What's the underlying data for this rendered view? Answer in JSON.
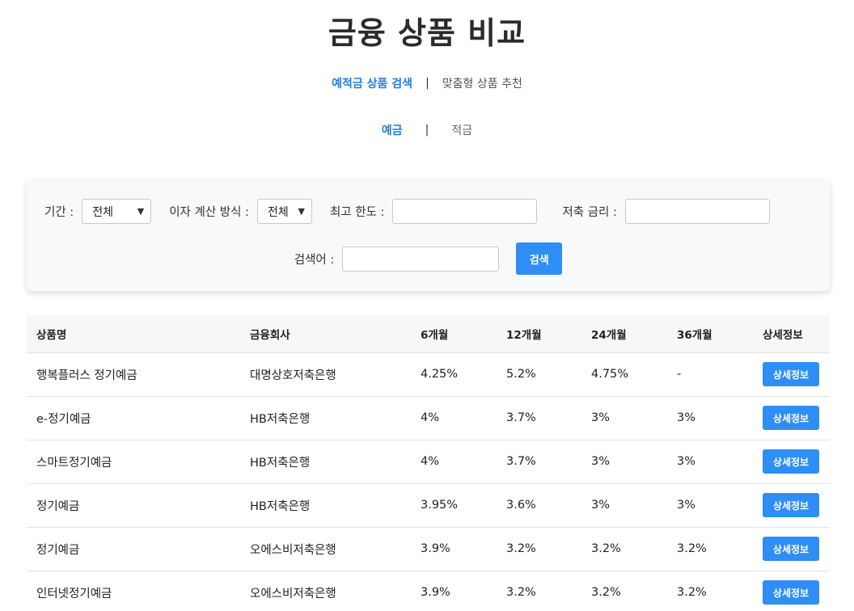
{
  "page": {
    "title": "금융 상품 비교"
  },
  "main_nav": {
    "items": [
      {
        "label": "예적금 상품 검색",
        "active": true
      },
      {
        "label": "맞춤형 상품 추천",
        "active": false
      }
    ],
    "separator": "|"
  },
  "sub_nav": {
    "items": [
      {
        "label": "예금",
        "active": true
      },
      {
        "label": "적금",
        "active": false
      }
    ],
    "separator": "|"
  },
  "filters": {
    "period_label": "기간 :",
    "period_value": "전체",
    "interest_label": "이자 계산 방식 :",
    "interest_value": "전체",
    "max_limit_label": "최고 한도 :",
    "max_limit_value": "",
    "rate_label": "저축 금리 :",
    "rate_value": "",
    "keyword_label": "검색어 :",
    "keyword_value": "",
    "search_button": "검색",
    "chevron_icon": "chevron-down-icon"
  },
  "table": {
    "headers": [
      "상품명",
      "금융회사",
      "6개월",
      "12개월",
      "24개월",
      "36개월",
      "상세정보"
    ],
    "detail_button": "상세정보",
    "button_color": "#2e8ef5",
    "rows": [
      {
        "name": "행복플러스 정기예금",
        "company": "대명상호저축은행",
        "m6": "4.25%",
        "m12": "5.2%",
        "m24": "4.75%",
        "m36": "-"
      },
      {
        "name": "e-정기예금",
        "company": "HB저축은행",
        "m6": "4%",
        "m12": "3.7%",
        "m24": "3%",
        "m36": "3%"
      },
      {
        "name": "스마트정기예금",
        "company": "HB저축은행",
        "m6": "4%",
        "m12": "3.7%",
        "m24": "3%",
        "m36": "3%"
      },
      {
        "name": "정기예금",
        "company": "HB저축은행",
        "m6": "3.95%",
        "m12": "3.6%",
        "m24": "3%",
        "m36": "3%"
      },
      {
        "name": "정기예금",
        "company": "오에스비저축은행",
        "m6": "3.9%",
        "m12": "3.2%",
        "m24": "3.2%",
        "m36": "3.2%"
      },
      {
        "name": "인터넷정기예금",
        "company": "오에스비저축은행",
        "m6": "3.9%",
        "m12": "3.2%",
        "m24": "3.2%",
        "m36": "3.2%"
      }
    ]
  },
  "colors": {
    "accent": "#1f7fe0",
    "button": "#2e8ef5",
    "panel_bg": "#f8f9fb"
  }
}
